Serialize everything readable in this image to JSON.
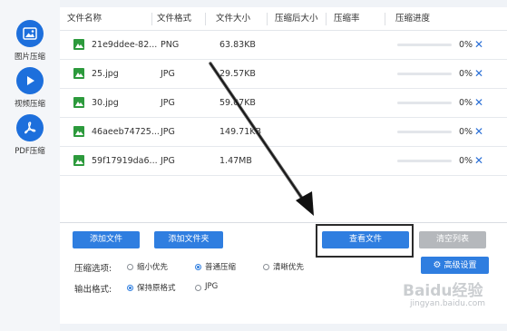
{
  "sidebar": {
    "items": [
      {
        "label": "图片压缩",
        "icon": "image-icon"
      },
      {
        "label": "视频压缩",
        "icon": "play-icon"
      },
      {
        "label": "PDF压缩",
        "icon": "pdf-icon"
      }
    ]
  },
  "table": {
    "headers": [
      "文件名称",
      "文件格式",
      "文件大小",
      "压缩后大小",
      "压缩率",
      "压缩进度"
    ],
    "rows": [
      {
        "name": "21e9ddee-82...",
        "format": "PNG",
        "size": "63.83KB",
        "compressed": "",
        "ratio": "",
        "progress": "0%"
      },
      {
        "name": "25.jpg",
        "format": "JPG",
        "size": "29.57KB",
        "compressed": "",
        "ratio": "",
        "progress": "0%"
      },
      {
        "name": "30.jpg",
        "format": "JPG",
        "size": "59.07KB",
        "compressed": "",
        "ratio": "",
        "progress": "0%"
      },
      {
        "name": "46aeeb74725...",
        "format": "JPG",
        "size": "149.71KB",
        "compressed": "",
        "ratio": "",
        "progress": "0%"
      },
      {
        "name": "59f17919da6...",
        "format": "JPG",
        "size": "1.47MB",
        "compressed": "",
        "ratio": "",
        "progress": "0%"
      }
    ]
  },
  "toolbar": {
    "add_file": "添加文件",
    "add_folder": "添加文件夹",
    "view_files": "查看文件",
    "clear_list": "清空列表",
    "advanced": "高级设置"
  },
  "options": {
    "compress_label": "压缩选项:",
    "compress_choices": [
      {
        "label": "缩小优先",
        "checked": false
      },
      {
        "label": "普通压缩",
        "checked": true
      },
      {
        "label": "清晰优先",
        "checked": false
      }
    ],
    "output_label": "输出格式:",
    "output_choices": [
      {
        "label": "保持原格式",
        "checked": true
      },
      {
        "label": "JPG",
        "checked": false
      }
    ]
  },
  "watermark": {
    "brand": "Baidu经验",
    "url": "jingyan.baidu.com"
  },
  "colors": {
    "accent": "#2f7ee0",
    "icon_green": "#2c9a3c",
    "button_gray": "#b5b8bc"
  }
}
